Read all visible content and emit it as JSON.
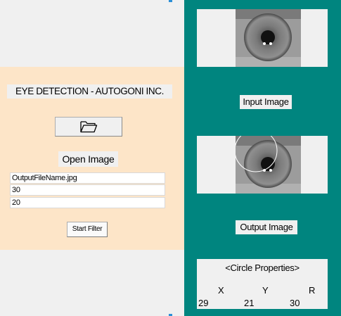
{
  "header": {
    "title": "EYE DETECTION - AUTOGONI INC."
  },
  "controls": {
    "open_icon": "folder-icon",
    "open_label": "Open Image",
    "output_filename": "OutputFileName.jpg",
    "param_1": "30",
    "param_2": "20",
    "start_button": "Start Filter"
  },
  "images": {
    "input_label": "Input Image",
    "output_label": "Output Image"
  },
  "circle": {
    "title": "<Circle Properties>",
    "x_label": "X",
    "y_label": "Y",
    "r_label": "R",
    "x_value": "29",
    "y_value": "21",
    "r_value": "30"
  },
  "colors": {
    "teal_panel": "#00857f",
    "peach_panel": "#fde5c8",
    "control_gray": "#f0f0f0"
  }
}
